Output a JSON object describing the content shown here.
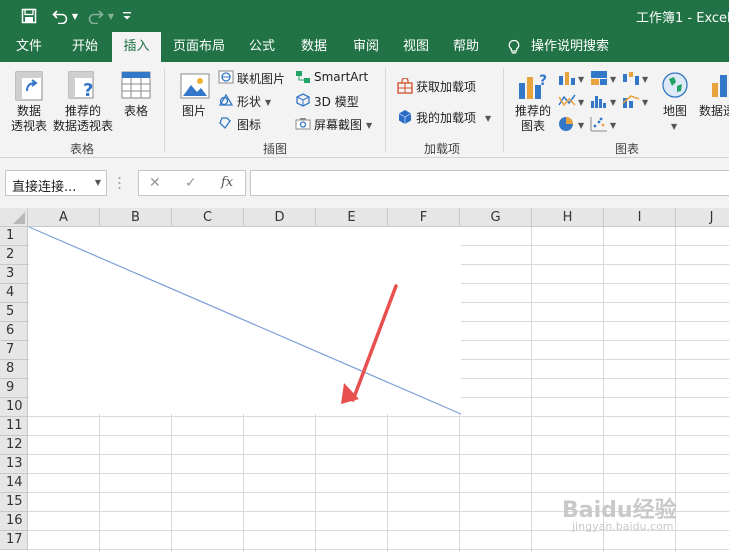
{
  "titlebar": {
    "title": "工作簿1 - Excel",
    "save_icon": "save-icon",
    "undo_icon": "undo-icon",
    "redo_icon": "redo-icon",
    "customize_icon": "customize-quick-access-icon"
  },
  "tabs": {
    "file": "文件",
    "home": "开始",
    "insert": "插入",
    "page_layout": "页面布局",
    "formulas": "公式",
    "data": "数据",
    "review": "审阅",
    "view": "视图",
    "help": "帮助",
    "tell_me": "操作说明搜索"
  },
  "ribbon": {
    "tables": {
      "pivot_table": [
        "数据",
        "透视表"
      ],
      "recommended_pivot": [
        "推荐的",
        "数据透视表"
      ],
      "table": "表格",
      "group_label": "表格"
    },
    "illustrations": {
      "pictures": "图片",
      "online_pictures": "联机图片",
      "shapes": "形状",
      "icons": "图标",
      "smartart": "SmartArt",
      "model3d": "3D 模型",
      "screenshot": "屏幕截图",
      "group_label": "插图"
    },
    "addins": {
      "get_addins": "获取加载项",
      "my_addins": "我的加载项",
      "group_label": "加载项"
    },
    "charts": {
      "recommended_charts": [
        "推荐的",
        "图表"
      ],
      "map": "地图",
      "pivot_chart": "数据透",
      "group_label": "图表"
    }
  },
  "formula_bar": {
    "name_box": "直接连接...",
    "cancel_symbol": "✕",
    "enter_symbol": "✓",
    "fx_symbol": "fx",
    "formula_value": ""
  },
  "sheet": {
    "columns": [
      "A",
      "B",
      "C",
      "D",
      "E",
      "F",
      "G",
      "H",
      "I",
      "J"
    ],
    "rows": [
      "1",
      "2",
      "3",
      "4",
      "5",
      "6",
      "7",
      "8",
      "9",
      "10",
      "11",
      "12",
      "13",
      "14",
      "15",
      "16",
      "17"
    ]
  },
  "watermark": {
    "brand": "Baidu经验",
    "url": "jingyan.baidu.com"
  },
  "colors": {
    "brand_green": "#217346",
    "line_shape": "#7f9fd6",
    "arrow": "#e8504f"
  }
}
